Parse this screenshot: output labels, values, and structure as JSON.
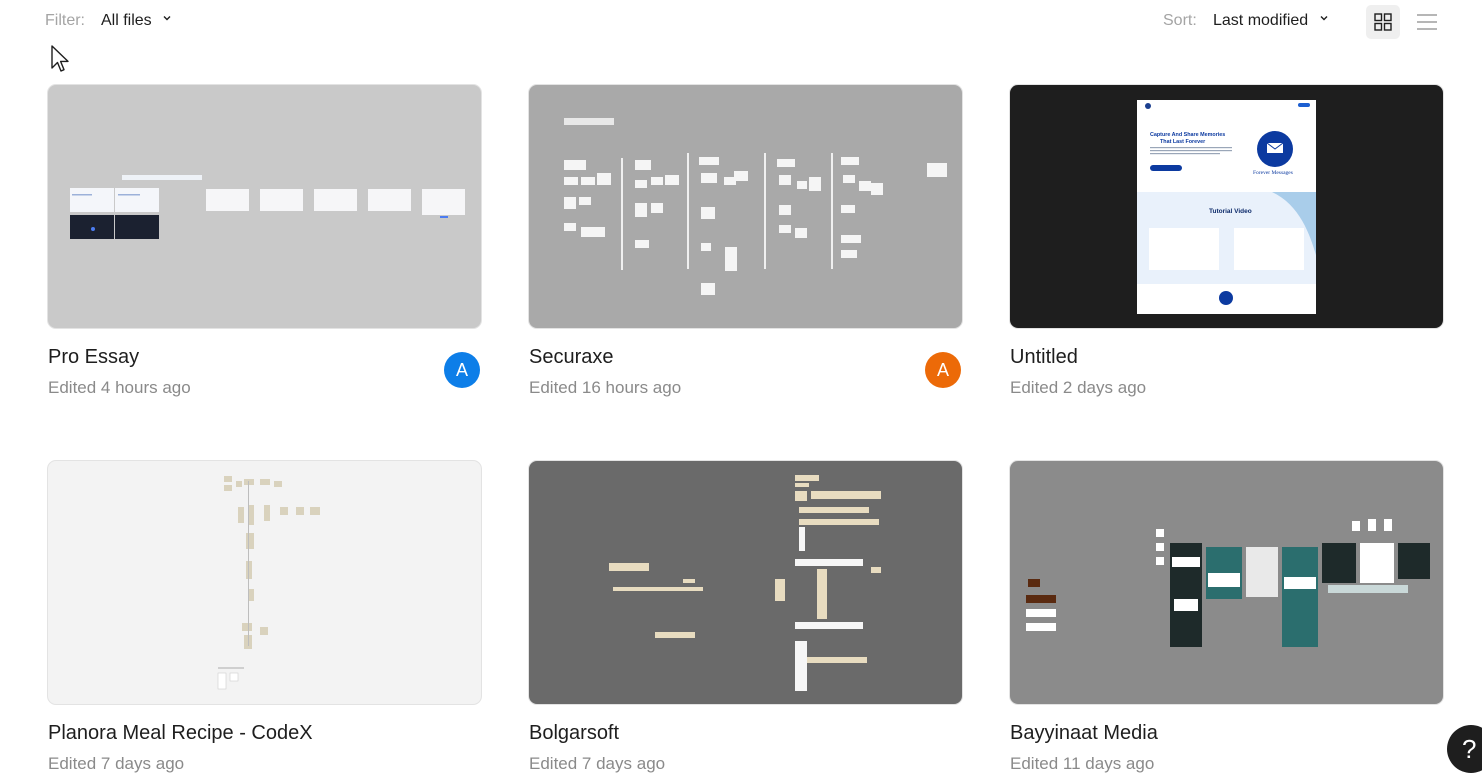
{
  "toolbar": {
    "filter_label": "Filter:",
    "filter_value": "All files",
    "sort_label": "Sort:",
    "sort_value": "Last modified",
    "grid_view_icon": "grid-view-icon",
    "list_view_icon": "list-view-icon"
  },
  "files": [
    {
      "title": "Pro Essay",
      "edited": "Edited 4 hours ago",
      "avatar": "A",
      "avatar_color": "#0d7ee8",
      "thumb_bg": "#c9c9c9"
    },
    {
      "title": "Securaxe",
      "edited": "Edited 16 hours ago",
      "avatar": "A",
      "avatar_color": "#ec6a08",
      "thumb_bg": "#a9a9a9"
    },
    {
      "title": "Untitled",
      "edited": "Edited 2 days ago",
      "thumb_bg": "#1e1e1e"
    },
    {
      "title": "Planora Meal Recipe - CodeX",
      "edited": "Edited 7 days ago",
      "thumb_bg": "#f3f3f3"
    },
    {
      "title": "Bolgarsoft",
      "edited": "Edited 7 days ago",
      "thumb_bg": "#6a6a6a"
    },
    {
      "title": "Bayyinaat Media",
      "edited": "Edited 11 days ago",
      "thumb_bg": "#8b8b8b"
    }
  ],
  "untitled_thumb": {
    "hero_title": "Capture And Share Memories That Last Forever",
    "brand": "Forever Messages",
    "section": "Tutorial Video"
  },
  "help": {
    "label": "?"
  },
  "colors": {
    "muted_text": "#8a8a8a",
    "toolbar_label": "#a4a4a4",
    "active_view_bg": "#efefef"
  }
}
